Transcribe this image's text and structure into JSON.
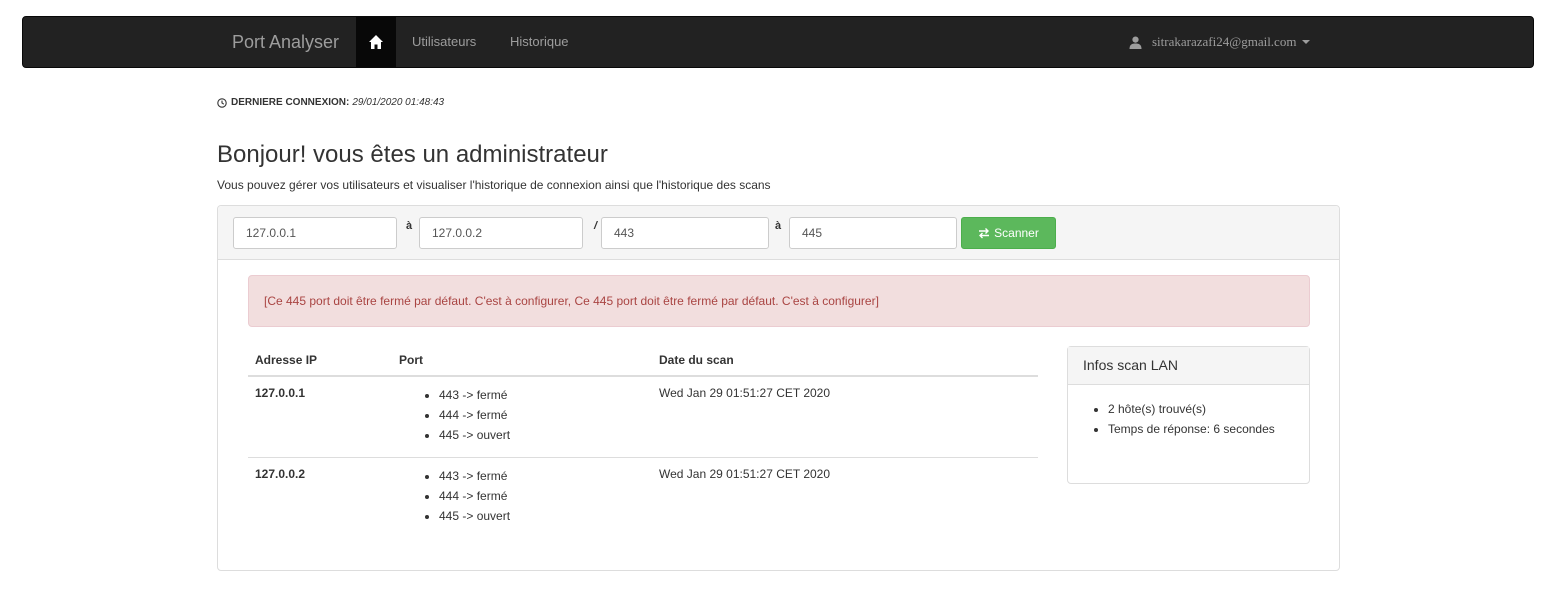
{
  "navbar": {
    "brand": "Port Analyser",
    "home_icon": "home-icon",
    "links": [
      "Utilisateurs",
      "Historique"
    ],
    "user_icon": "user-icon",
    "user_email": "sitrakarazafi24@gmail.com"
  },
  "last_connection": {
    "icon": "clock-icon",
    "label": "DERNIERE CONNEXION:",
    "value": "29/01/2020 01:48:43"
  },
  "page": {
    "title": "Bonjour! vous êtes un administrateur",
    "subtitle": "Vous pouvez gérer vos utilisateurs et visualiser l'historique de connexion ainsi que l'historique des scans"
  },
  "scan_form": {
    "ip_start": "127.0.0.1",
    "ip_end": "127.0.0.2",
    "port_start": "443",
    "port_end": "445",
    "sep_ip": "à",
    "sep_slash": "/",
    "sep_port": "à",
    "scan_button": "Scanner",
    "scan_icon": "exchange-icon"
  },
  "alert": {
    "message": "[Ce 445 port doit être fermé par défaut. C'est à configurer, Ce 445 port doit être fermé par défaut. C'est à configurer]"
  },
  "results": {
    "headers": [
      "Adresse IP",
      "Port",
      "Date du scan"
    ],
    "rows": [
      {
        "ip": "127.0.0.1",
        "ports": [
          "443 -> fermé",
          "444 -> fermé",
          "445 -> ouvert"
        ],
        "date": "Wed Jan 29 01:51:27 CET 2020"
      },
      {
        "ip": "127.0.0.2",
        "ports": [
          "443 -> fermé",
          "444 -> fermé",
          "445 -> ouvert"
        ],
        "date": "Wed Jan 29 01:51:27 CET 2020"
      }
    ]
  },
  "lan_info": {
    "title": "Infos scan LAN",
    "items": [
      "2 hôte(s) trouvé(s)",
      "Temps de réponse: 6 secondes"
    ]
  },
  "colors": {
    "navbar_bg": "#222222",
    "success": "#5cb85c",
    "danger_bg": "#f2dede",
    "danger_text": "#a94442"
  }
}
